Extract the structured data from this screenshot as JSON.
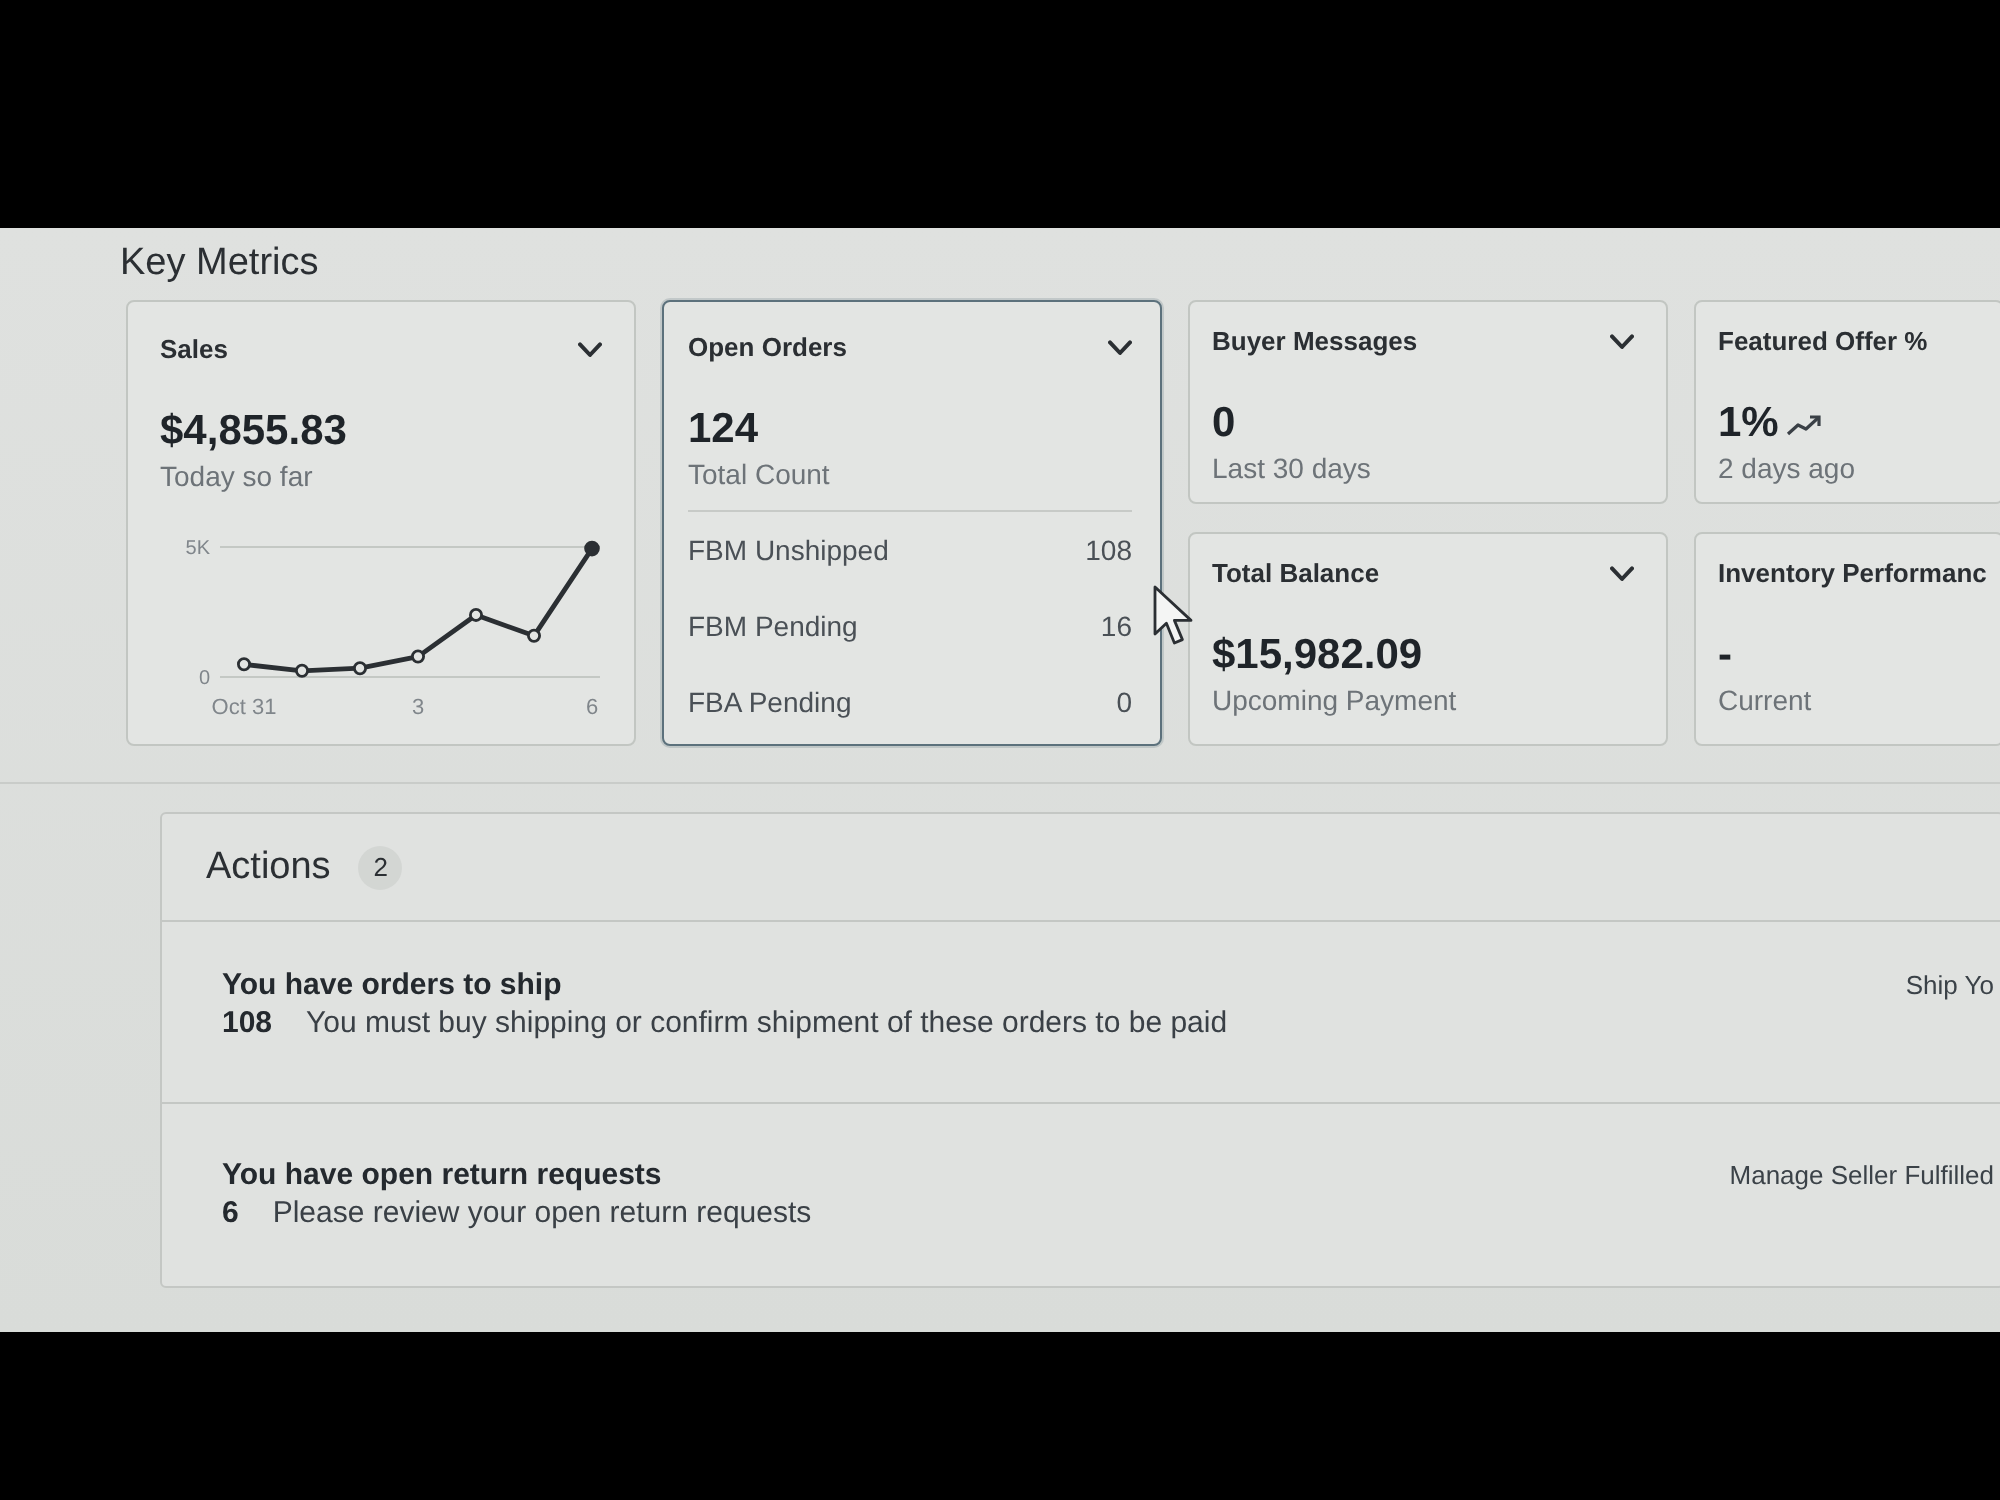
{
  "section_title": "Key Metrics",
  "metrics": [
    {
      "kind": "chart",
      "title": "Sales",
      "menu": true,
      "hovered": false,
      "trending": false,
      "value": "$4,855.83",
      "caption": "Today so far",
      "chart_data": {
        "type": "line",
        "categories": [
          "Oct 31",
          null,
          null,
          "3",
          null,
          null,
          "6"
        ],
        "values": [
          450,
          200,
          300,
          750,
          2350,
          1550,
          4900
        ],
        "color": "#2b2f33",
        "marker": "circle",
        "yticks": [
          {
            "value": 0,
            "label": "0"
          },
          {
            "value": 5000,
            "label": "5K"
          }
        ],
        "ylim": [
          0,
          5000
        ]
      }
    },
    {
      "kind": "breakdown",
      "title": "Open Orders",
      "menu": true,
      "hovered": true,
      "trending": false,
      "value": "124",
      "caption": "Total Count",
      "rows": [
        {
          "label": "FBM Unshipped",
          "value": "108"
        },
        {
          "label": "FBM Pending",
          "value": "16"
        },
        {
          "label": "FBA Pending",
          "value": "0"
        }
      ]
    },
    {
      "kind": "simple",
      "title": "Buyer Messages",
      "menu": true,
      "hovered": false,
      "trending": false,
      "value": "0",
      "caption": "Last 30 days"
    },
    {
      "kind": "simple",
      "title": "Featured Offer %",
      "menu": false,
      "hovered": false,
      "trending": true,
      "value": "1%",
      "caption": "2 days ago"
    },
    {
      "kind": "simple",
      "title": "Total Balance",
      "menu": true,
      "hovered": false,
      "trending": false,
      "value": "$15,982.09",
      "caption": "Upcoming Payment"
    },
    {
      "kind": "simple",
      "title": "Inventory Performanc",
      "menu": false,
      "hovered": false,
      "trending": false,
      "value": "-",
      "caption": "Current"
    }
  ],
  "actions": {
    "title": "Actions",
    "count": "2",
    "items": [
      {
        "title": "You have orders to ship",
        "count": "108",
        "description": "You must buy shipping or confirm shipment of these orders to be paid",
        "link": "Ship Yo"
      },
      {
        "title": "You have open return requests",
        "count": "6",
        "description": "Please review your open return requests",
        "link": "Manage Seller Fulfilled"
      }
    ]
  }
}
